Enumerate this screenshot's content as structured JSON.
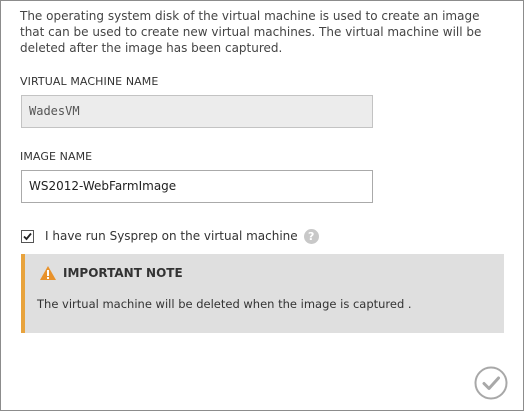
{
  "intro_text": "The operating system disk of the virtual machine is used to create an image that can be used to create new virtual machines. The virtual machine will be deleted after the image has been captured.",
  "vm_name": {
    "label": "VIRTUAL MACHINE NAME",
    "value": "WadesVM"
  },
  "image_name": {
    "label": "IMAGE NAME",
    "value": "WS2012-WebFarmImage"
  },
  "sysprep": {
    "label": "I have run Sysprep on the virtual machine",
    "checked": true,
    "help_icon": "question-mark-circle"
  },
  "note": {
    "icon": "warning-triangle",
    "title": "IMPORTANT NOTE",
    "body": "The virtual machine will be deleted when the image is captured ."
  },
  "ok_button": {
    "icon": "checkmark-circle"
  },
  "colors": {
    "note_accent": "#e8a33d",
    "note_background": "#dfdfdf",
    "readonly_field": "#ececec"
  }
}
